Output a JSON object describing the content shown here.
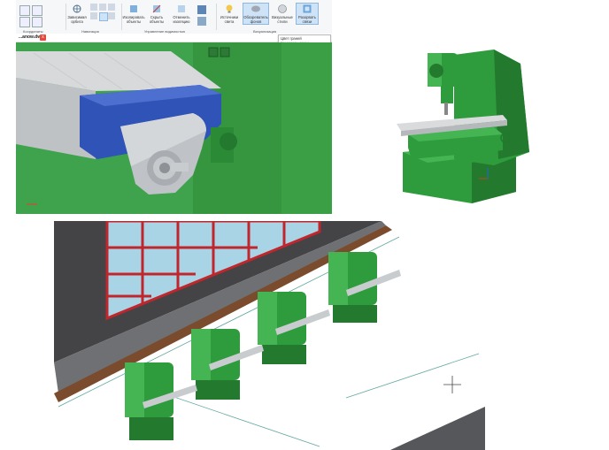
{
  "ribbon": {
    "groups": [
      {
        "label": "Координаты"
      },
      {
        "label": "Навигация"
      },
      {
        "label": "Управление видимостью"
      },
      {
        "label": "Визуализация"
      }
    ],
    "buttons": [
      {
        "label": "Зависимая орбита",
        "icon": "orbit-icon"
      },
      {
        "label": "Изолировать объекты",
        "icon": "isolate-icon"
      },
      {
        "label": "Скрыть объекты",
        "icon": "hide-icon"
      },
      {
        "label": "Отменить изоляцию",
        "icon": "unisolate-icon"
      },
      {
        "label": "Источники света",
        "icon": "light-icon"
      },
      {
        "label": "Обозреватель фонов",
        "icon": "background-icon"
      },
      {
        "label": "Визуальные стили",
        "icon": "visual-styles-icon"
      },
      {
        "label": "Разорвать связи",
        "icon": "break-links-icon"
      }
    ],
    "accent": "#2b6cb0"
  },
  "document": {
    "tab_label": "...anow.dwg*",
    "close_symbol": "x"
  },
  "tooltip": {
    "title": "Цвет граней",
    "subtitle": "Разорвать связи"
  },
  "colors": {
    "machine_green": "#2e9c3c",
    "machine_dark": "#1f7a2c",
    "table_gray": "#c9ccce",
    "vise_blue": "#2f53b7",
    "window_frame_red": "#c0262c",
    "glass_blue": "#a9d4e6",
    "floor_brown": "#7a4b2c",
    "floor_gray": "#707070"
  }
}
